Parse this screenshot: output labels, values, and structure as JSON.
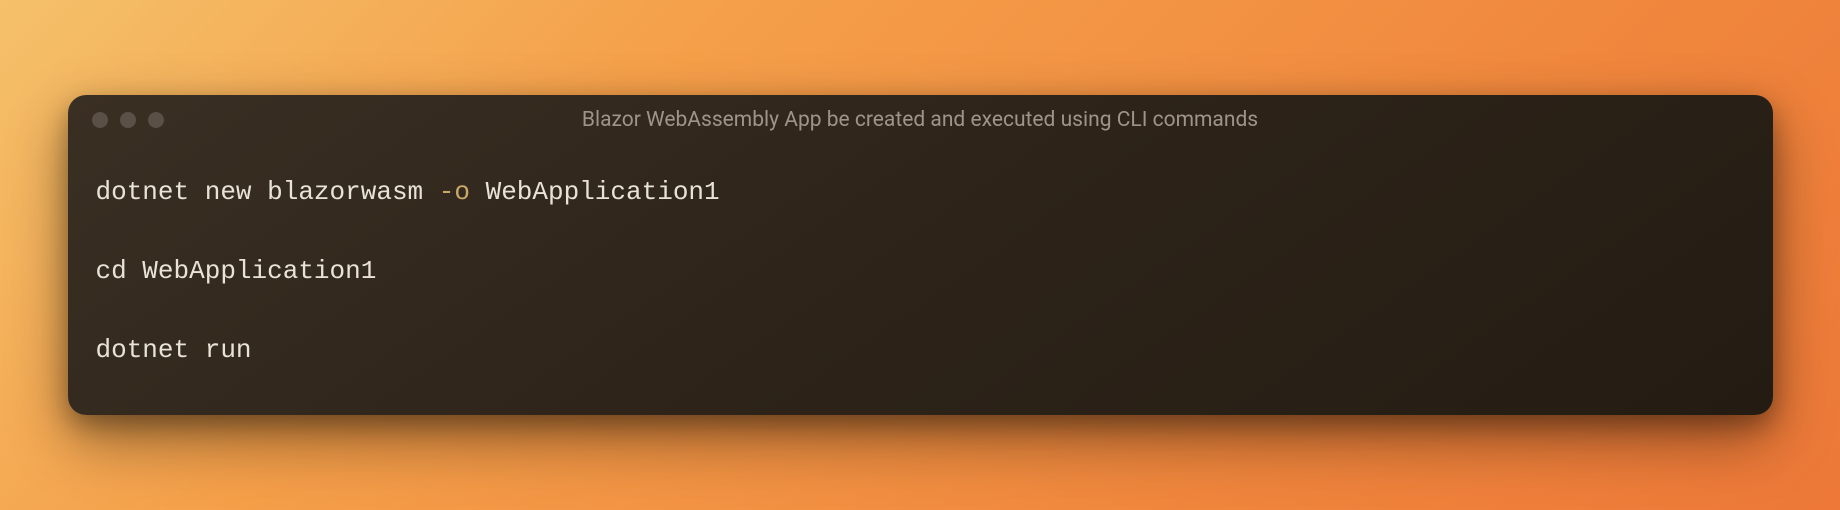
{
  "window": {
    "title": "Blazor WebAssembly App be created and executed using CLI commands"
  },
  "code": {
    "line1_part1": "dotnet new blazorwasm ",
    "line1_flag": "-o",
    "line1_part2": " WebApplication1",
    "line2": "cd WebApplication1",
    "line3": "dotnet run"
  },
  "colors": {
    "window_bg": "#2d2319",
    "text": "#e8e2d8",
    "flag": "#c9a968",
    "title": "#a09488",
    "traffic_light": "#5a5048"
  }
}
